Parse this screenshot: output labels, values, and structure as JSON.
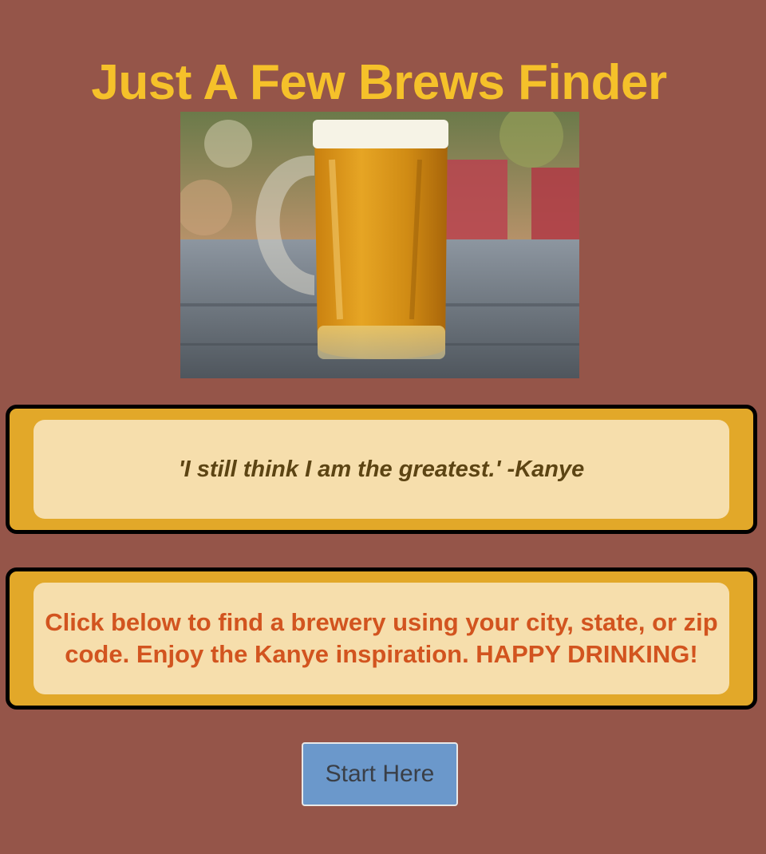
{
  "header": {
    "title": "Just A Few Brews Finder"
  },
  "hero": {
    "image_subject": "beer-mug-photo"
  },
  "quote": {
    "text": "'I still think I am the greatest.' -Kanye"
  },
  "info": {
    "text": "Click below to find a brewery using your city, state, or zip code. Enjoy the Kanye inspiration. HAPPY DRINKING!"
  },
  "actions": {
    "start_label": "Start Here"
  },
  "colors": {
    "page_background": "#955549",
    "title": "#f5c12a",
    "card_border_fill": "#e2a829",
    "card_inner": "#f6deac",
    "quote_text": "#5c4413",
    "info_text": "#d2541f",
    "button": "#6b98cb"
  }
}
